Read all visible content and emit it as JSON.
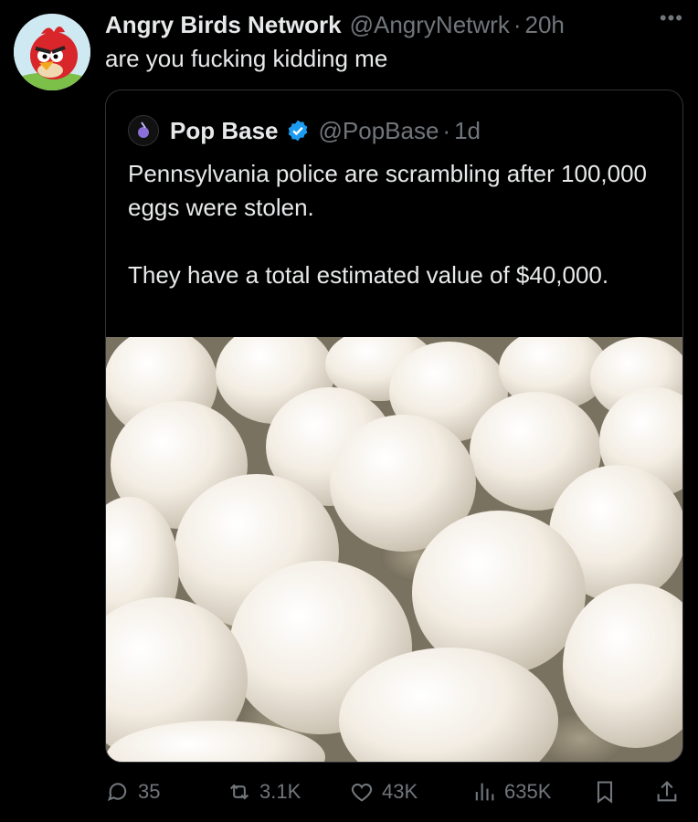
{
  "tweet": {
    "author_name": "Angry Birds Network",
    "handle": "@AngryNetwrk",
    "separator": "·",
    "time": "20h",
    "more_icon": "more-horizontal-icon",
    "text": "are you fucking kidding me"
  },
  "quote": {
    "author_name": "Pop Base",
    "verified_icon": "verified-badge-icon",
    "handle": "@PopBase",
    "separator": "·",
    "time": "1d",
    "paragraph1": "Pennsylvania police are scrambling after 100,000 eggs were stolen.",
    "paragraph2": "They have a total estimated value of $40,000.",
    "media_icon": "photo-eggs"
  },
  "actions": {
    "replies": "35",
    "reposts": "3.1K",
    "likes": "43K",
    "views": "635K"
  },
  "colors": {
    "background": "#000000",
    "text": "#e7e9ea",
    "muted": "#71767b",
    "verified": "#1d9bf0",
    "border": "#2f3336"
  }
}
